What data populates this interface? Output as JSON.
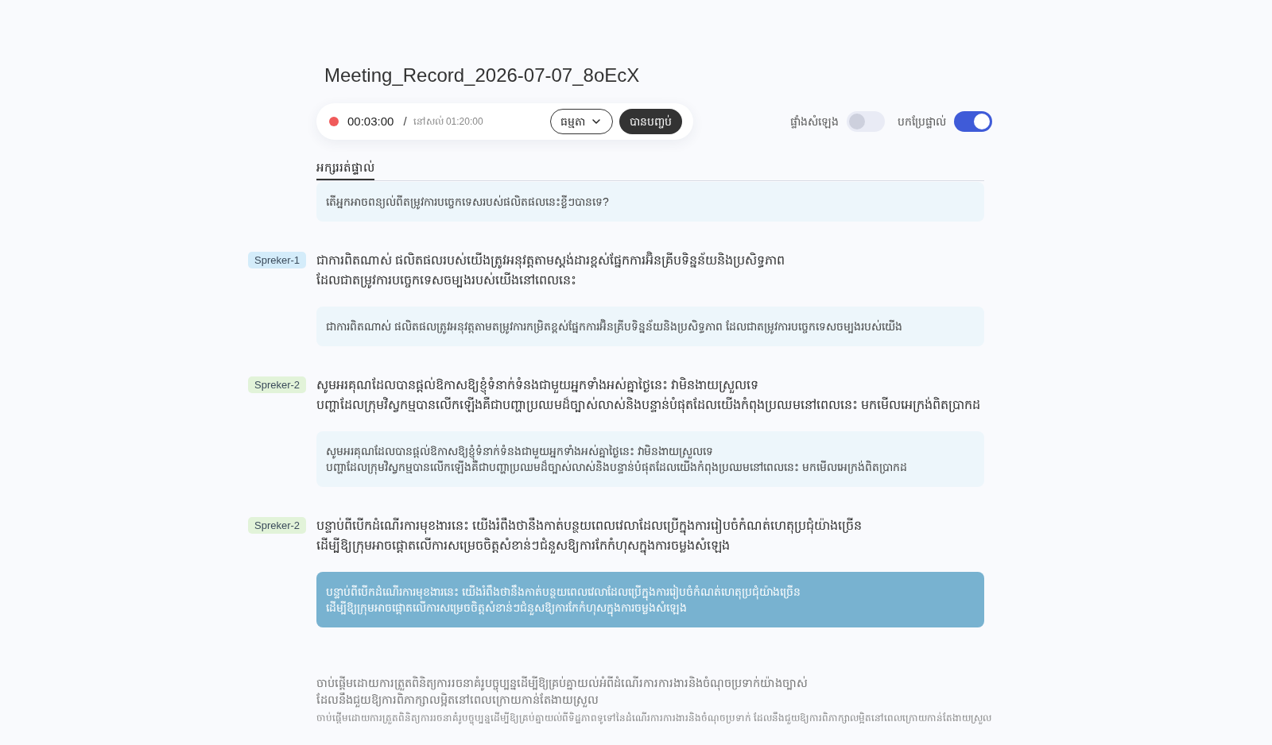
{
  "title": "Meeting_Record_2026-07-07_8oEcX",
  "recorder": {
    "elapsed": "00:03:00",
    "separator": "/",
    "remaining": "នៅសល់ 01:20:00",
    "mode": "ធម្មតា",
    "finish_button": "បានបញ្ចប់"
  },
  "toggles": [
    {
      "label": "ផ្ទាំងសំឡេង",
      "on": false
    },
    {
      "label": "បកប្រែផ្ទាល់",
      "on": true
    }
  ],
  "tabs": [
    {
      "label": "អក្សររត់ផ្ទាល់",
      "selected": true
    }
  ],
  "segments": [
    {
      "translation": "តើអ្នកអាចពន្យល់ពីតម្រូវការបច្ចេកទេសរបស់ផលិតផលនេះខ្លីៗបានទេ?",
      "selected": false
    },
    {
      "speaker": {
        "label": "Spreker-1",
        "color": "#d4ecfa"
      },
      "text": "ជាការពិតណាស់ ផលិតផលរបស់យើងត្រូវអនុវត្តតាមស្តង់ដារខ្ពស់ផ្នែកការអ៊ិនគ្រីបទិន្នន័យនិងប្រសិទ្ធភាព\nដែលជាតម្រូវការបច្ចេកទេសចម្បងរបស់យើងនៅពេលនេះ",
      "translation": "ជាការពិតណាស់ ផលិតផលត្រូវអនុវត្តតាមតម្រូវការកម្រិតខ្ពស់ផ្នែកការអ៊ិនគ្រីបទិន្នន័យនិងប្រសិទ្ធភាព ដែលជាតម្រូវការបច្ចេកទេសចម្បងរបស់យើង",
      "selected": false
    },
    {
      "speaker": {
        "label": "Spreker-2",
        "color": "#e2f3d9"
      },
      "text": "សូមអរគុណដែលបានផ្តល់ឱកាសឱ្យខ្ញុំទំនាក់ទំនងជាមួយអ្នកទាំងអស់គ្នាថ្ងៃនេះ វាមិនងាយស្រួលទេ\nបញ្ហាដែលក្រុមវិស្វកម្មបានលើកឡើងគឺជាបញ្ហាប្រឈមដ៏ច្បាស់លាស់និងបន្ទាន់បំផុតដែលយើងកំពុងប្រឈមនៅពេលនេះ មកមើលអេក្រង់ពិតប្រាកដ",
      "translation": "សូមអរគុណដែលបានផ្តល់ឱកាសឱ្យខ្ញុំទំនាក់ទំនងជាមួយអ្នកទាំងអស់គ្នាថ្ងៃនេះ វាមិនងាយស្រួលទេ\nបញ្ហាដែលក្រុមវិស្វកម្មបានលើកឡើងគឺជាបញ្ហាប្រឈមដ៏ច្បាស់លាស់និងបន្ទាន់បំផុតដែលយើងកំពុងប្រឈមនៅពេលនេះ មកមើលអេក្រង់ពិតប្រាកដ",
      "selected": false
    },
    {
      "speaker": {
        "label": "Spreker-2",
        "color": "#e2f3d9"
      },
      "text": "បន្ទាប់ពីបើកដំណើរការមុខងារនេះ យើងរំពឹងថានឹងកាត់បន្ថយពេលវេលាដែលប្រើក្នុងការរៀបចំកំណត់ហេតុប្រជុំយ៉ាងច្រើន\nដើម្បីឱ្យក្រុមអាចផ្តោតលើការសម្រេចចិត្តសំខាន់ៗជំនួសឱ្យការកែកំហុសក្នុងការចម្លងសំឡេង",
      "translation": "បន្ទាប់ពីបើកដំណើរការមុខងារនេះ យើងរំពឹងថានឹងកាត់បន្ថយពេលវេលាដែលប្រើក្នុងការរៀបចំកំណត់ហេតុប្រជុំយ៉ាងច្រើន\nដើម្បីឱ្យក្រុមអាចផ្តោតលើការសម្រេចចិត្តសំខាន់ៗជំនួសឱ្យការកែកំហុសក្នុងការចម្លងសំឡេង",
      "selected": true
    }
  ],
  "live_segment": {
    "text": "ចាប់ផ្តើមដោយការត្រួតពិនិត្យការរចនាគំរូបច្ចុប្បន្នដើម្បីឱ្យគ្រប់គ្នាយល់អំពីដំណើរការការងារនិងចំណុចប្រទាក់យ៉ាងច្បាស់\nដែលនឹងជួយឱ្យការពិភាក្សាលម្អិតនៅពេលក្រោយកាន់តែងាយស្រួល",
    "translation": "ចាប់ផ្តើមដោយការត្រួតពិនិត្យការរចនាគំរូបច្ចុប្បន្នដើម្បីឱ្យគ្រប់គ្នាយល់ពីទិដ្ឋភាពទូទៅនៃដំណើរការការងារនិងចំណុចប្រទាក់ ដែលនឹងជួយឱ្យការពិភាក្សាលម្អិតនៅពេលក្រោយកាន់តែងាយស្រួល"
  }
}
